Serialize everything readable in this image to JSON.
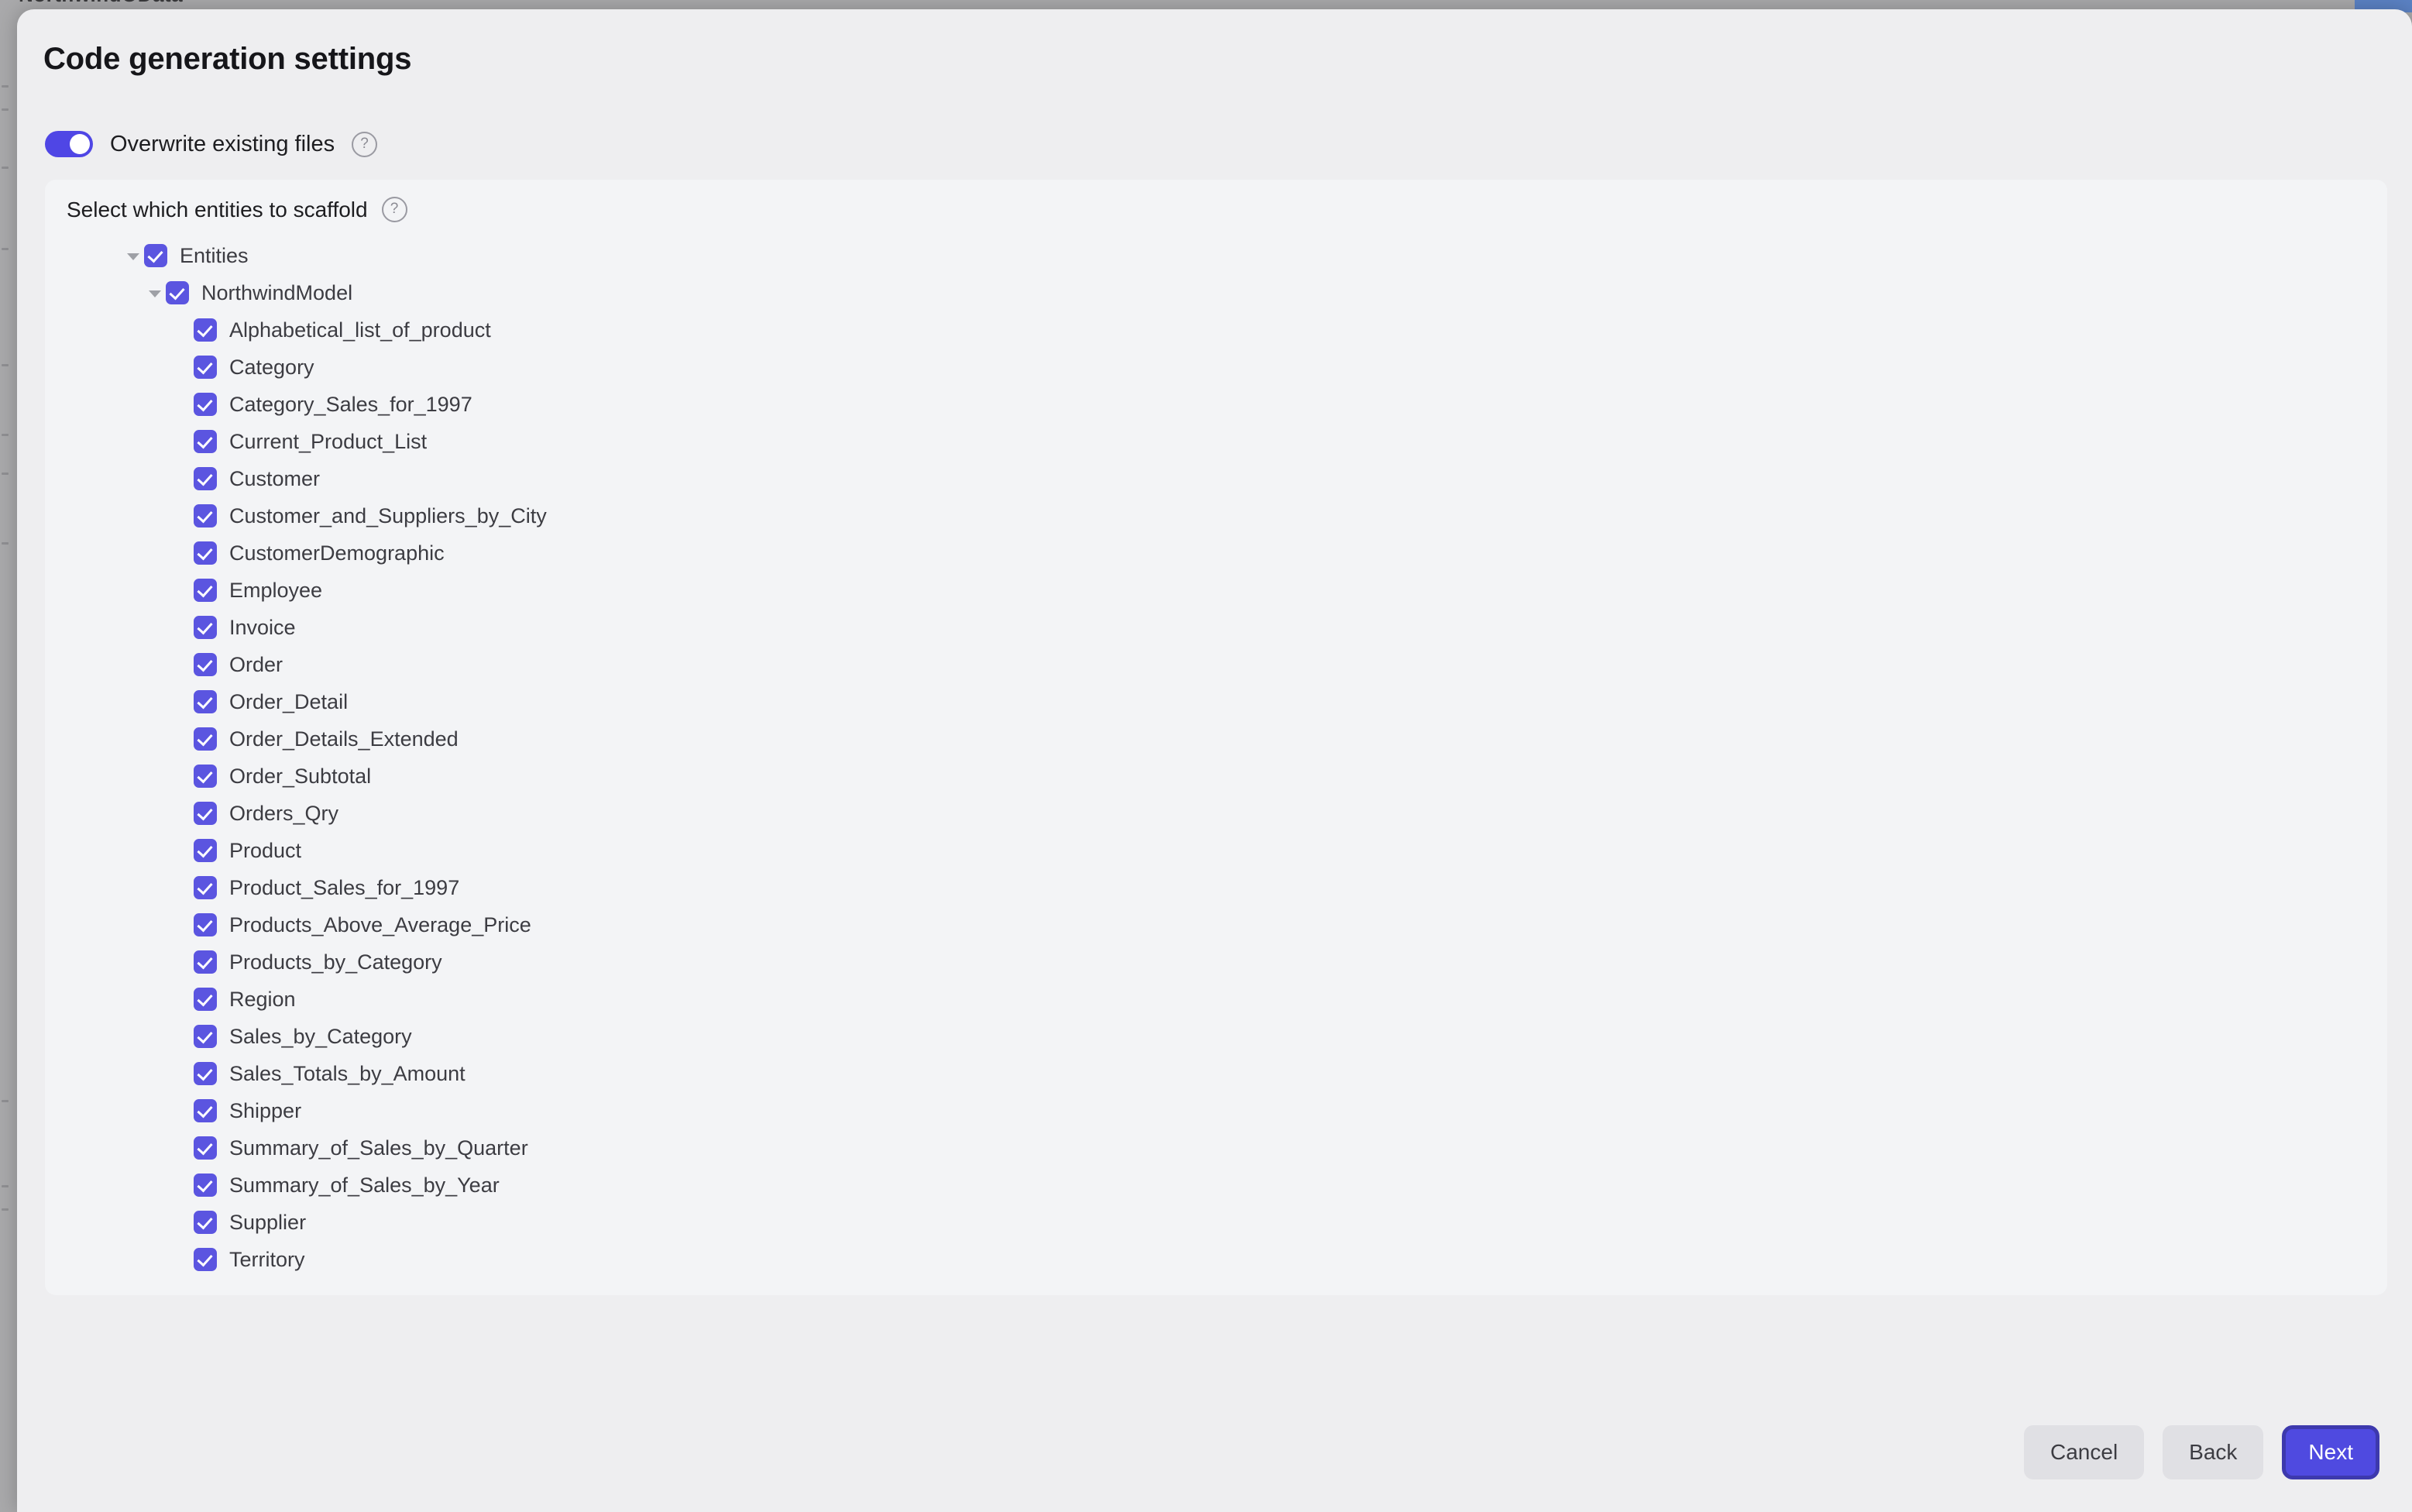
{
  "background": {
    "title_sliver": "NorthwindOData",
    "accent_color": "#5b82c4"
  },
  "dialog": {
    "title": "Code generation settings",
    "accent_color": "#4f46e5",
    "surface_color": "#eeeef0",
    "panel_color": "#f3f4f6"
  },
  "overwrite": {
    "label": "Overwrite existing files",
    "state": "on",
    "help_icon": "help-circle-icon",
    "help_glyph": "?"
  },
  "entities_panel": {
    "heading": "Select which entities to scaffold",
    "help_icon": "help-circle-icon",
    "help_glyph": "?"
  },
  "tree": {
    "root": {
      "label": "Entities",
      "checked": true,
      "expanded": true
    },
    "model": {
      "label": "NorthwindModel",
      "checked": true,
      "expanded": true
    },
    "entities": [
      {
        "label": "Alphabetical_list_of_product",
        "checked": true
      },
      {
        "label": "Category",
        "checked": true
      },
      {
        "label": "Category_Sales_for_1997",
        "checked": true
      },
      {
        "label": "Current_Product_List",
        "checked": true
      },
      {
        "label": "Customer",
        "checked": true
      },
      {
        "label": "Customer_and_Suppliers_by_City",
        "checked": true
      },
      {
        "label": "CustomerDemographic",
        "checked": true
      },
      {
        "label": "Employee",
        "checked": true
      },
      {
        "label": "Invoice",
        "checked": true
      },
      {
        "label": "Order",
        "checked": true
      },
      {
        "label": "Order_Detail",
        "checked": true
      },
      {
        "label": "Order_Details_Extended",
        "checked": true
      },
      {
        "label": "Order_Subtotal",
        "checked": true
      },
      {
        "label": "Orders_Qry",
        "checked": true
      },
      {
        "label": "Product",
        "checked": true
      },
      {
        "label": "Product_Sales_for_1997",
        "checked": true
      },
      {
        "label": "Products_Above_Average_Price",
        "checked": true
      },
      {
        "label": "Products_by_Category",
        "checked": true
      },
      {
        "label": "Region",
        "checked": true
      },
      {
        "label": "Sales_by_Category",
        "checked": true
      },
      {
        "label": "Sales_Totals_by_Amount",
        "checked": true
      },
      {
        "label": "Shipper",
        "checked": true
      },
      {
        "label": "Summary_of_Sales_by_Quarter",
        "checked": true
      },
      {
        "label": "Summary_of_Sales_by_Year",
        "checked": true
      },
      {
        "label": "Supplier",
        "checked": true
      },
      {
        "label": "Territory",
        "checked": true
      }
    ]
  },
  "footer": {
    "cancel_label": "Cancel",
    "back_label": "Back",
    "next_label": "Next"
  }
}
